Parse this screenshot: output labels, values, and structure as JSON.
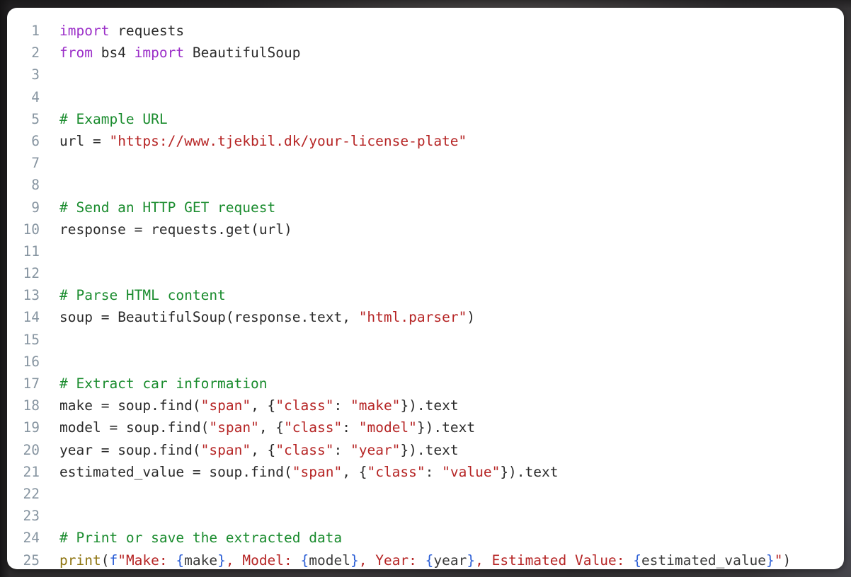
{
  "card": {
    "background_color": "#ffffff",
    "page_background_color": "#2e2c2d"
  },
  "palette": {
    "keyword": "#9b2ec8",
    "comment": "#1a8c2e",
    "string": "#b62525",
    "name": "#2b2b2b",
    "function": "#8f7512",
    "fstring_prefix": "#2c5fd6",
    "fstring_brace": "#2c5fd6",
    "line_number": "#8795a1"
  },
  "code": {
    "language": "python",
    "line_numbers": [
      "1",
      "2",
      "3",
      "4",
      "5",
      "6",
      "7",
      "8",
      "9",
      "10",
      "11",
      "12",
      "13",
      "14",
      "15",
      "16",
      "17",
      "18",
      "19",
      "20",
      "21",
      "22",
      "23",
      "24",
      "25"
    ],
    "lines": [
      {
        "n": "1",
        "plain": "import requests",
        "tokens": [
          {
            "t": "import",
            "c": "tok-kw"
          },
          {
            "t": " requests",
            "c": "tok-nam"
          }
        ]
      },
      {
        "n": "2",
        "plain": "from bs4 import BeautifulSoup",
        "tokens": [
          {
            "t": "from",
            "c": "tok-kw"
          },
          {
            "t": " bs4 ",
            "c": "tok-nam"
          },
          {
            "t": "import",
            "c": "tok-kw"
          },
          {
            "t": " BeautifulSoup",
            "c": "tok-nam"
          }
        ]
      },
      {
        "n": "3",
        "plain": "",
        "tokens": []
      },
      {
        "n": "4",
        "plain": "",
        "tokens": []
      },
      {
        "n": "5",
        "plain": "# Example URL",
        "tokens": [
          {
            "t": "# Example URL",
            "c": "tok-com"
          }
        ]
      },
      {
        "n": "6",
        "plain": "url = \"https://www.tjekbil.dk/your-license-plate\"",
        "tokens": [
          {
            "t": "url ",
            "c": "tok-nam"
          },
          {
            "t": "= ",
            "c": "tok-pun"
          },
          {
            "t": "\"https://www.tjekbil.dk/your-license-plate\"",
            "c": "tok-str"
          }
        ]
      },
      {
        "n": "7",
        "plain": "",
        "tokens": []
      },
      {
        "n": "8",
        "plain": "",
        "tokens": []
      },
      {
        "n": "9",
        "plain": "# Send an HTTP GET request",
        "tokens": [
          {
            "t": "# Send an HTTP GET request",
            "c": "tok-com"
          }
        ]
      },
      {
        "n": "10",
        "plain": "response = requests.get(url)",
        "tokens": [
          {
            "t": "response ",
            "c": "tok-nam"
          },
          {
            "t": "= ",
            "c": "tok-pun"
          },
          {
            "t": "requests",
            "c": "tok-nam"
          },
          {
            "t": ".",
            "c": "tok-pun"
          },
          {
            "t": "get",
            "c": "tok-nam"
          },
          {
            "t": "(",
            "c": "tok-pun"
          },
          {
            "t": "url",
            "c": "tok-nam"
          },
          {
            "t": ")",
            "c": "tok-pun"
          }
        ]
      },
      {
        "n": "11",
        "plain": "",
        "tokens": []
      },
      {
        "n": "12",
        "plain": "",
        "tokens": []
      },
      {
        "n": "13",
        "plain": "# Parse HTML content",
        "tokens": [
          {
            "t": "# Parse HTML content",
            "c": "tok-com"
          }
        ]
      },
      {
        "n": "14",
        "plain": "soup = BeautifulSoup(response.text, \"html.parser\")",
        "tokens": [
          {
            "t": "soup ",
            "c": "tok-nam"
          },
          {
            "t": "= ",
            "c": "tok-pun"
          },
          {
            "t": "BeautifulSoup",
            "c": "tok-nam"
          },
          {
            "t": "(",
            "c": "tok-pun"
          },
          {
            "t": "response",
            "c": "tok-nam"
          },
          {
            "t": ".",
            "c": "tok-pun"
          },
          {
            "t": "text",
            "c": "tok-nam"
          },
          {
            "t": ", ",
            "c": "tok-pun"
          },
          {
            "t": "\"html.parser\"",
            "c": "tok-str"
          },
          {
            "t": ")",
            "c": "tok-pun"
          }
        ]
      },
      {
        "n": "15",
        "plain": "",
        "tokens": []
      },
      {
        "n": "16",
        "plain": "",
        "tokens": []
      },
      {
        "n": "17",
        "plain": "# Extract car information",
        "tokens": [
          {
            "t": "# Extract car information",
            "c": "tok-com"
          }
        ]
      },
      {
        "n": "18",
        "plain": "make = soup.find(\"span\", {\"class\": \"make\"}).text",
        "tokens": [
          {
            "t": "make ",
            "c": "tok-nam"
          },
          {
            "t": "= ",
            "c": "tok-pun"
          },
          {
            "t": "soup",
            "c": "tok-nam"
          },
          {
            "t": ".",
            "c": "tok-pun"
          },
          {
            "t": "find",
            "c": "tok-nam"
          },
          {
            "t": "(",
            "c": "tok-pun"
          },
          {
            "t": "\"span\"",
            "c": "tok-str"
          },
          {
            "t": ", {",
            "c": "tok-pun"
          },
          {
            "t": "\"class\"",
            "c": "tok-str"
          },
          {
            "t": ": ",
            "c": "tok-pun"
          },
          {
            "t": "\"make\"",
            "c": "tok-str"
          },
          {
            "t": "}).",
            "c": "tok-pun"
          },
          {
            "t": "text",
            "c": "tok-nam"
          }
        ]
      },
      {
        "n": "19",
        "plain": "model = soup.find(\"span\", {\"class\": \"model\"}).text",
        "tokens": [
          {
            "t": "model ",
            "c": "tok-nam"
          },
          {
            "t": "= ",
            "c": "tok-pun"
          },
          {
            "t": "soup",
            "c": "tok-nam"
          },
          {
            "t": ".",
            "c": "tok-pun"
          },
          {
            "t": "find",
            "c": "tok-nam"
          },
          {
            "t": "(",
            "c": "tok-pun"
          },
          {
            "t": "\"span\"",
            "c": "tok-str"
          },
          {
            "t": ", {",
            "c": "tok-pun"
          },
          {
            "t": "\"class\"",
            "c": "tok-str"
          },
          {
            "t": ": ",
            "c": "tok-pun"
          },
          {
            "t": "\"model\"",
            "c": "tok-str"
          },
          {
            "t": "}).",
            "c": "tok-pun"
          },
          {
            "t": "text",
            "c": "tok-nam"
          }
        ]
      },
      {
        "n": "20",
        "plain": "year = soup.find(\"span\", {\"class\": \"year\"}).text",
        "tokens": [
          {
            "t": "year ",
            "c": "tok-nam"
          },
          {
            "t": "= ",
            "c": "tok-pun"
          },
          {
            "t": "soup",
            "c": "tok-nam"
          },
          {
            "t": ".",
            "c": "tok-pun"
          },
          {
            "t": "find",
            "c": "tok-nam"
          },
          {
            "t": "(",
            "c": "tok-pun"
          },
          {
            "t": "\"span\"",
            "c": "tok-str"
          },
          {
            "t": ", {",
            "c": "tok-pun"
          },
          {
            "t": "\"class\"",
            "c": "tok-str"
          },
          {
            "t": ": ",
            "c": "tok-pun"
          },
          {
            "t": "\"year\"",
            "c": "tok-str"
          },
          {
            "t": "}).",
            "c": "tok-pun"
          },
          {
            "t": "text",
            "c": "tok-nam"
          }
        ]
      },
      {
        "n": "21",
        "plain": "estimated_value = soup.find(\"span\", {\"class\": \"value\"}).text",
        "tokens": [
          {
            "t": "estimated_value ",
            "c": "tok-nam"
          },
          {
            "t": "= ",
            "c": "tok-pun"
          },
          {
            "t": "soup",
            "c": "tok-nam"
          },
          {
            "t": ".",
            "c": "tok-pun"
          },
          {
            "t": "find",
            "c": "tok-nam"
          },
          {
            "t": "(",
            "c": "tok-pun"
          },
          {
            "t": "\"span\"",
            "c": "tok-str"
          },
          {
            "t": ", {",
            "c": "tok-pun"
          },
          {
            "t": "\"class\"",
            "c": "tok-str"
          },
          {
            "t": ": ",
            "c": "tok-pun"
          },
          {
            "t": "\"value\"",
            "c": "tok-str"
          },
          {
            "t": "}).",
            "c": "tok-pun"
          },
          {
            "t": "text",
            "c": "tok-nam"
          }
        ]
      },
      {
        "n": "22",
        "plain": "",
        "tokens": []
      },
      {
        "n": "23",
        "plain": "",
        "tokens": []
      },
      {
        "n": "24",
        "plain": "# Print or save the extracted data",
        "tokens": [
          {
            "t": "# Print or save the extracted data",
            "c": "tok-com"
          }
        ]
      },
      {
        "n": "25",
        "plain": "print(f\"Make: {make}, Model: {model}, Year: {year}, Estimated Value: {estimated_value}\")",
        "tokens": [
          {
            "t": "print",
            "c": "tok-fn"
          },
          {
            "t": "(",
            "c": "tok-pun"
          },
          {
            "t": "f",
            "c": "tok-fpre"
          },
          {
            "t": "\"Make: ",
            "c": "tok-str"
          },
          {
            "t": "{",
            "c": "tok-brc"
          },
          {
            "t": "make",
            "c": "tok-sub"
          },
          {
            "t": "}",
            "c": "tok-brc"
          },
          {
            "t": ", Model: ",
            "c": "tok-str"
          },
          {
            "t": "{",
            "c": "tok-brc"
          },
          {
            "t": "model",
            "c": "tok-sub"
          },
          {
            "t": "}",
            "c": "tok-brc"
          },
          {
            "t": ", Year: ",
            "c": "tok-str"
          },
          {
            "t": "{",
            "c": "tok-brc"
          },
          {
            "t": "year",
            "c": "tok-sub"
          },
          {
            "t": "}",
            "c": "tok-brc"
          },
          {
            "t": ", Estimated Value: ",
            "c": "tok-str"
          },
          {
            "t": "{",
            "c": "tok-brc"
          },
          {
            "t": "estimated_value",
            "c": "tok-sub"
          },
          {
            "t": "}",
            "c": "tok-brc"
          },
          {
            "t": "\"",
            "c": "tok-str"
          },
          {
            "t": ")",
            "c": "tok-pun"
          }
        ]
      }
    ]
  }
}
